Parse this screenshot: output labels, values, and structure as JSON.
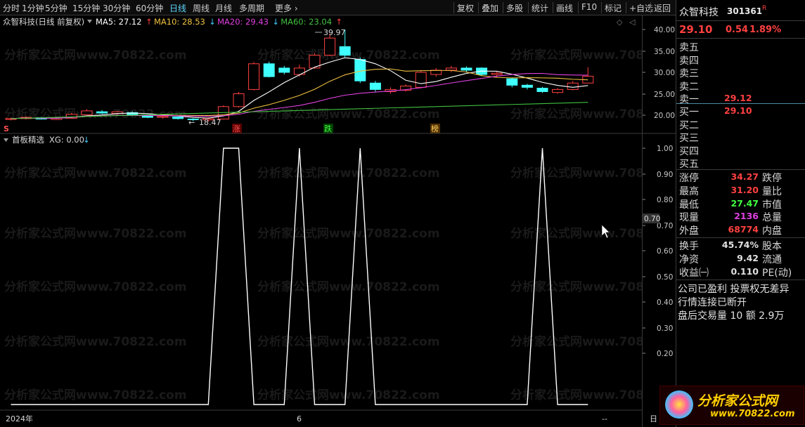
{
  "toolbar": {
    "periods": [
      "分时",
      "1分钟",
      "5分钟",
      "15分钟",
      "30分钟",
      "60分钟",
      "日线",
      "周线",
      "月线",
      "多周期",
      "更多"
    ],
    "active_period": "日线",
    "tools": [
      "复权",
      "叠加",
      "多股",
      "统计",
      "画线",
      "F10",
      "标记",
      "+自选",
      "返回"
    ]
  },
  "main_chart": {
    "title": "众智科技(日线 前复权)",
    "ma_legend": [
      {
        "label": "MA5: 27.12",
        "arrow": "↑",
        "color": "#ffffff",
        "arrow_color": "#ff4040"
      },
      {
        "label": "MA10: 28.53",
        "arrow": "↓",
        "color": "#f0c040",
        "arrow_color": "#40d0ff"
      },
      {
        "label": "MA20: 29.43",
        "arrow": "↓",
        "color": "#e040e0",
        "arrow_color": "#40d0ff"
      },
      {
        "label": "MA60: 23.04",
        "arrow": "↑",
        "color": "#40c040",
        "arrow_color": "#ff4040"
      }
    ],
    "high_label": "39.97",
    "low_label": "18.47",
    "y_ticks": [
      "40.00",
      "35.00",
      "30.00",
      "25.00",
      "20.00"
    ],
    "markers": [
      {
        "text": "涨",
        "color": "#ff5050",
        "bg": "#5a0000"
      },
      {
        "text": "跌",
        "color": "#40ff40",
        "bg": "#004000"
      },
      {
        "text": "榜",
        "color": "#ffd060",
        "bg": "#503000"
      }
    ],
    "s_marker": "S"
  },
  "indicator": {
    "title": "首板精选",
    "legend": "XG: 0.00",
    "arrow": "↓",
    "y_ticks": [
      "1.00",
      "0.90",
      "0.80",
      "0.70",
      "0.60",
      "0.50",
      "0.40",
      "0.30",
      "0.20"
    ],
    "crosshair_value": "0.70"
  },
  "x_axis": {
    "labels": [
      "2024年",
      "6",
      "--"
    ]
  },
  "right_bottom_label": "日",
  "chart_data": {
    "type": "line",
    "title": "首板精选",
    "series": [
      {
        "name": "XG",
        "values": [
          0,
          0,
          0,
          0,
          0,
          0,
          0,
          0,
          0,
          0,
          0,
          0,
          0,
          0,
          1,
          1,
          0,
          0,
          0,
          1,
          0,
          0,
          0,
          1,
          0,
          0,
          0,
          0,
          0,
          0,
          0,
          0,
          0,
          0,
          0,
          1,
          0,
          0,
          0
        ]
      }
    ],
    "ylim": [
      0,
      1
    ],
    "grid": false
  },
  "quote": {
    "name": "众智科技",
    "code": "301361",
    "code_badge": "R",
    "price": "29.10",
    "change": "0.54",
    "change_pct": "1.89%",
    "sells": [
      {
        "label": "卖五",
        "price": "",
        "vol": ""
      },
      {
        "label": "卖四",
        "price": "",
        "vol": ""
      },
      {
        "label": "卖三",
        "price": "",
        "vol": ""
      },
      {
        "label": "卖二",
        "price": "",
        "vol": ""
      },
      {
        "label": "卖一",
        "price": "29.12",
        "vol": ""
      }
    ],
    "buys": [
      {
        "label": "买一",
        "price": "29.10",
        "vol": ""
      },
      {
        "label": "买二",
        "price": "",
        "vol": ""
      },
      {
        "label": "买三",
        "price": "",
        "vol": ""
      },
      {
        "label": "买四",
        "price": "",
        "vol": ""
      },
      {
        "label": "买五",
        "price": "",
        "vol": ""
      }
    ],
    "stats": [
      {
        "l1": "涨停",
        "v1": "34.27",
        "c1": "#ff4040",
        "l2": "跌停"
      },
      {
        "l1": "最高",
        "v1": "31.20",
        "c1": "#ff4040",
        "l2": "量比"
      },
      {
        "l1": "最低",
        "v1": "27.47",
        "c1": "#40ff40",
        "l2": "市值"
      },
      {
        "l1": "现量",
        "v1": "2136",
        "c1": "#e040e0",
        "l2": "总量"
      },
      {
        "l1": "外盘",
        "v1": "68774",
        "c1": "#ff4040",
        "l2": "内盘"
      }
    ],
    "stats2": [
      {
        "l1": "换手",
        "v1": "45.74%",
        "c1": "#e0e0e0",
        "l2": "股本"
      },
      {
        "l1": "净资",
        "v1": "9.42",
        "c1": "#e0e0e0",
        "l2": "流通"
      },
      {
        "l1": "收益㈠",
        "v1": "0.110",
        "c1": "#e0e0e0",
        "l2": "PE(动)"
      }
    ],
    "notes": [
      "公司已盈利 投票权无差异",
      "行情连接已断开",
      "盘后交易量 10 额 2.9万"
    ]
  },
  "watermark": "分析家公式网www.70822.com",
  "logo": {
    "text": "分析家公式网",
    "url": "www.70822.com"
  },
  "colors": {
    "up": "#ff4040",
    "down": "#40ffff",
    "bg": "#000000"
  }
}
